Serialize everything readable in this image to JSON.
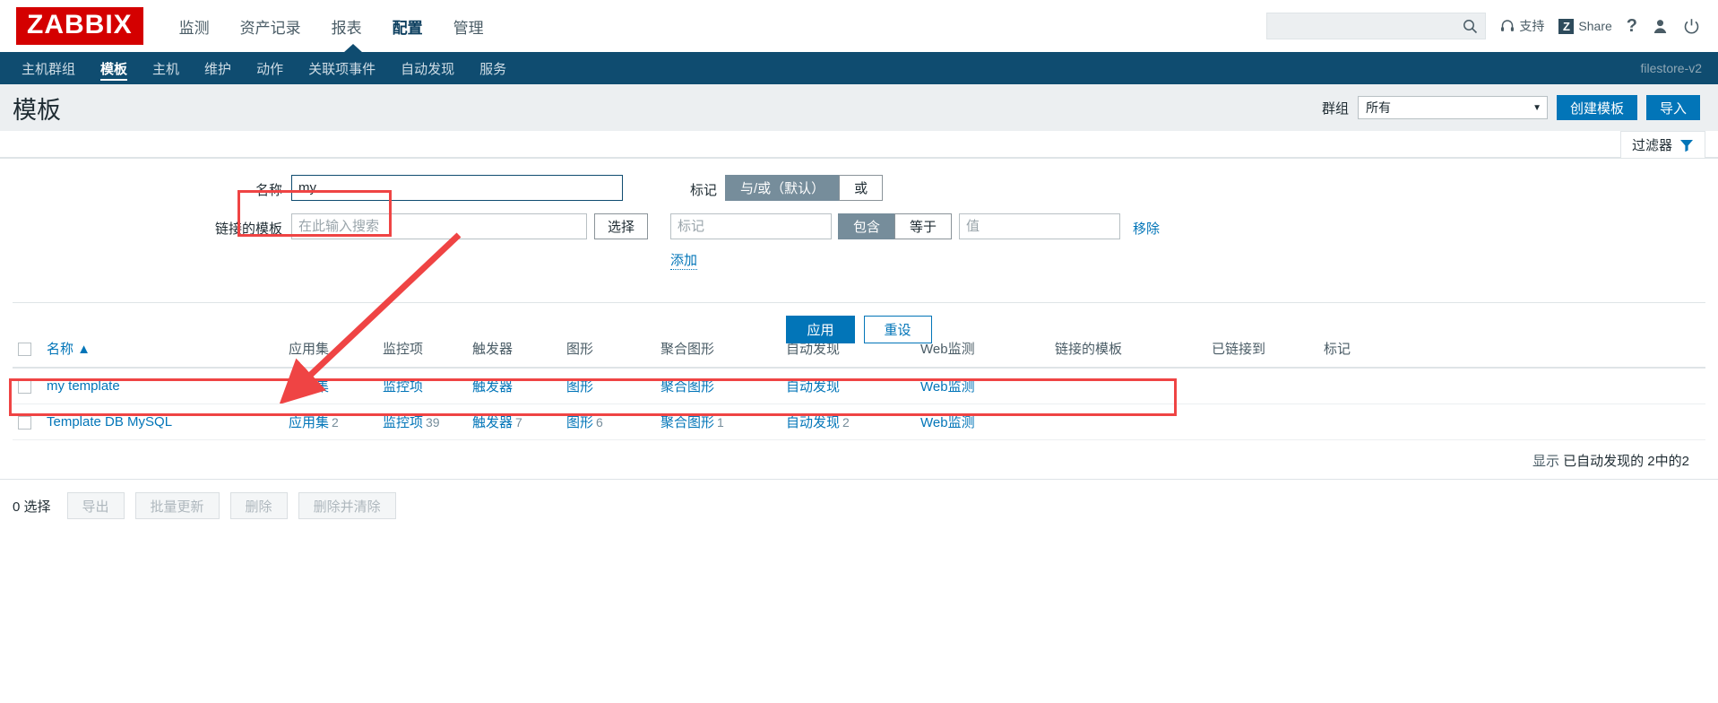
{
  "header": {
    "logo": "ZABBIX",
    "nav": [
      {
        "label": "监测",
        "active": false
      },
      {
        "label": "资产记录",
        "active": false
      },
      {
        "label": "报表",
        "active": false
      },
      {
        "label": "配置",
        "active": true
      },
      {
        "label": "管理",
        "active": false
      }
    ],
    "search": {
      "value": "",
      "placeholder": ""
    },
    "support_label": "支持",
    "share_label": "Share",
    "share_badge": "Z",
    "help_label": "?",
    "icons": {
      "search": "search-icon",
      "support": "headset-icon",
      "user": "user-icon",
      "signout": "power-icon"
    }
  },
  "subnav": {
    "items": [
      {
        "label": "主机群组",
        "active": false
      },
      {
        "label": "模板",
        "active": true
      },
      {
        "label": "主机",
        "active": false
      },
      {
        "label": "维护",
        "active": false
      },
      {
        "label": "动作",
        "active": false
      },
      {
        "label": "关联项事件",
        "active": false
      },
      {
        "label": "自动发现",
        "active": false
      },
      {
        "label": "服务",
        "active": false
      }
    ],
    "server": "filestore-v2"
  },
  "title_row": {
    "title": "模板",
    "group_label": "群组",
    "group_value": "所有",
    "create_label": "创建模板",
    "import_label": "导入"
  },
  "filter_tab": {
    "label": "过滤器",
    "icon": "funnel-icon"
  },
  "filter": {
    "name_label": "名称",
    "name_value": "my",
    "linked_label": "链接的模板",
    "linked_placeholder": "在此输入搜索",
    "linked_value": "",
    "select_button": "选择",
    "tags_label": "标记",
    "tag_logic": [
      {
        "label": "与/或（默认）",
        "on": true
      },
      {
        "label": "或",
        "on": false
      }
    ],
    "tag_name_placeholder": "标记",
    "tag_name_value": "",
    "tag_operators": [
      {
        "label": "包含",
        "on": true
      },
      {
        "label": "等于",
        "on": false
      }
    ],
    "tag_value_placeholder": "值",
    "tag_value_value": "",
    "remove_label": "移除",
    "add_label": "添加",
    "apply_label": "应用",
    "reset_label": "重设"
  },
  "table": {
    "columns": [
      "名称 ▲",
      "应用集",
      "监控项",
      "触发器",
      "图形",
      "聚合图形",
      "自动发现",
      "Web监测",
      "链接的模板",
      "已链接到",
      "标记"
    ],
    "rows": [
      {
        "name": "my template",
        "applications": {
          "label": "应用集",
          "count": ""
        },
        "items": {
          "label": "监控项",
          "count": ""
        },
        "triggers": {
          "label": "触发器",
          "count": ""
        },
        "graphs": {
          "label": "图形",
          "count": ""
        },
        "screens": {
          "label": "聚合图形",
          "count": ""
        },
        "discovery": {
          "label": "自动发现",
          "count": ""
        },
        "web": {
          "label": "Web监测",
          "count": ""
        },
        "linked_templates": "",
        "linked_to": "",
        "tags": ""
      },
      {
        "name": "Template DB MySQL",
        "applications": {
          "label": "应用集",
          "count": "2"
        },
        "items": {
          "label": "监控项",
          "count": "39"
        },
        "triggers": {
          "label": "触发器",
          "count": "7"
        },
        "graphs": {
          "label": "图形",
          "count": "6"
        },
        "screens": {
          "label": "聚合图形",
          "count": "1"
        },
        "discovery": {
          "label": "自动发现",
          "count": "2"
        },
        "web": {
          "label": "Web监测",
          "count": ""
        },
        "linked_templates": "",
        "linked_to": "",
        "tags": ""
      }
    ],
    "summary_prefix": "显示",
    "summary_text": "已自动发现的 2中的2"
  },
  "footer": {
    "selected_text": "0 选择",
    "buttons": [
      {
        "label": "导出",
        "disabled": true
      },
      {
        "label": "批量更新",
        "disabled": true
      },
      {
        "label": "删除",
        "disabled": true
      },
      {
        "label": "删除并清除",
        "disabled": true
      }
    ]
  },
  "annotations": {
    "highlight_color": "#ef4444"
  }
}
